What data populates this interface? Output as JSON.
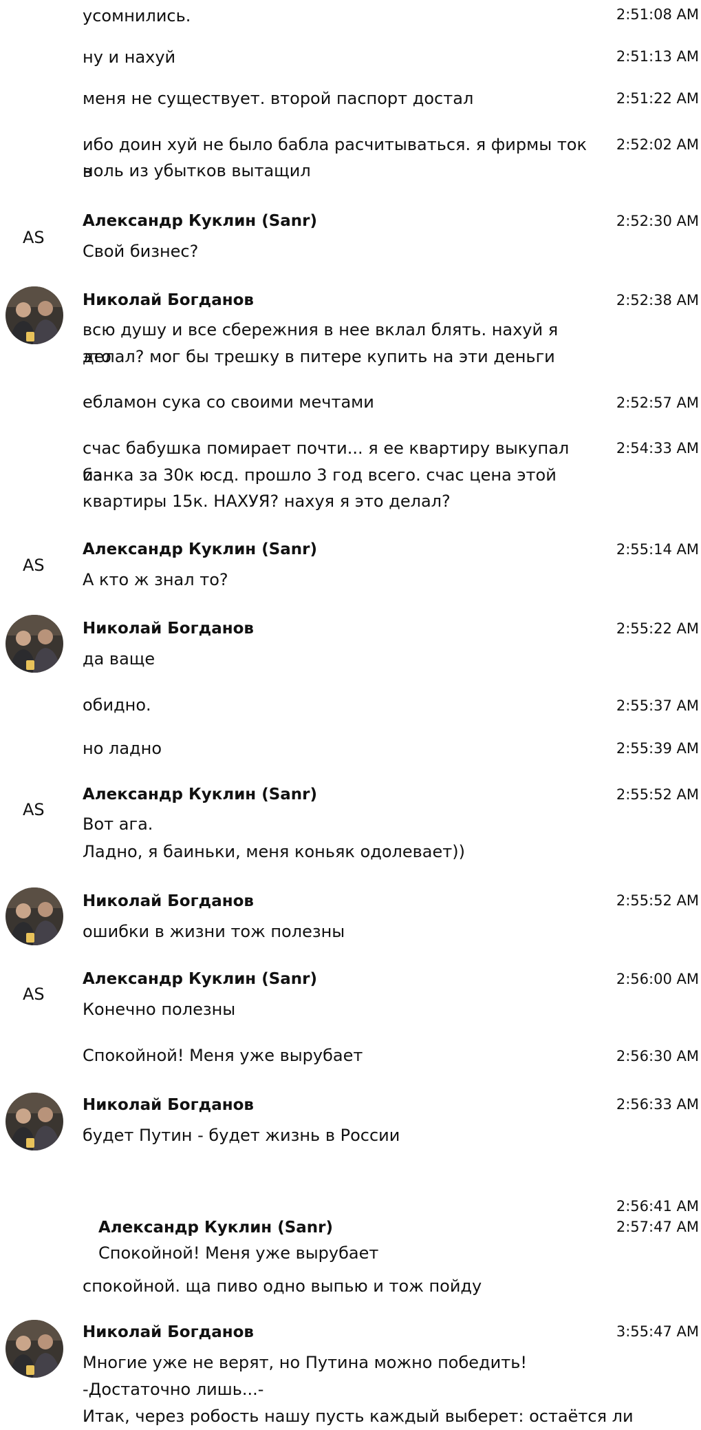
{
  "participants": {
    "sanr": {
      "name": "Александр Куклин (Sanr)",
      "initials": "AS"
    },
    "nikolai": {
      "name": "Николай Богданов",
      "avatar_icon": "user-photo-avatar"
    }
  },
  "messages": [
    {
      "text": "усомнились.",
      "time": "2:51:08 AM"
    },
    {
      "text": "ну и нахуй",
      "time": "2:51:13 AM"
    },
    {
      "text": "меня не существует. второй паспорт достал",
      "time": "2:51:22 AM"
    },
    {
      "text_lines": [
        "ибо доин хуй не было бабла расчитываться. я фирмы ток в",
        "ноль из убытков вытащил"
      ],
      "time": "2:52:02 AM"
    },
    {
      "sender": "Александр Куклин (Sanr)",
      "initials": "AS",
      "text": "Свой бизнес?",
      "time": "2:52:30 AM"
    },
    {
      "sender": "Николай Богданов",
      "text_lines": [
        "всю душу и все сбережния в нее вклал блять. нахуй я это",
        "делал? мог бы трешку в питере купить на эти деньги"
      ],
      "time": "2:52:38 AM"
    },
    {
      "text": "ебламон сука со своими мечтами",
      "time": "2:52:57 AM"
    },
    {
      "text_lines": [
        "счас бабушка помирает почти... я ее квартиру выкупал из",
        "банка за 30к юсд. прошло 3 год всего. счас цена этой",
        "квартиры 15к. НАХУЯ? нахуя я это делал?"
      ],
      "time": "2:54:33 AM"
    },
    {
      "sender": "Александр Куклин (Sanr)",
      "initials": "AS",
      "text": "А кто ж знал то?",
      "time": "2:55:14 AM"
    },
    {
      "sender": "Николай Богданов",
      "text": "да ваще",
      "time": "2:55:22 AM"
    },
    {
      "text": "обидно.",
      "time": "2:55:37 AM"
    },
    {
      "text": "но ладно",
      "time": "2:55:39 AM"
    },
    {
      "sender": "Александр Куклин (Sanr)",
      "initials": "AS",
      "text_lines": [
        "Вот ага.",
        "Ладно, я баиньки, меня коньяк одолевает))"
      ],
      "time": "2:55:52 AM"
    },
    {
      "sender": "Николай Богданов",
      "text": "ошибки в жизни тож полезны",
      "time": "2:55:52 AM"
    },
    {
      "sender": "Александр Куклин (Sanr)",
      "initials": "AS",
      "text": "Конечно полезны",
      "time": "2:56:00 AM"
    },
    {
      "text": "Спокойной! Меня уже вырубает",
      "time": "2:56:30 AM"
    },
    {
      "sender": "Николай Богданов",
      "text": "будет Путин - будет жизнь в России",
      "time": "2:56:33 AM"
    },
    {
      "text": "",
      "time": "2:56:41 AM"
    },
    {
      "quote_sender": "Александр Куклин (Sanr)",
      "quote_text": "Спокойной! Меня уже вырубает",
      "text": "спокойной. ща пиво одно выпью и тож пойду",
      "time": "2:57:47 AM"
    },
    {
      "sender": "Николай Богданов",
      "text_lines": [
        "Многие уже не верят, но Путина можно победить!",
        "-Достаточно лишь...-",
        "Итак, через робость нашу пусть каждый выберет: остаётся ли"
      ],
      "time": "3:55:47 AM"
    }
  ]
}
